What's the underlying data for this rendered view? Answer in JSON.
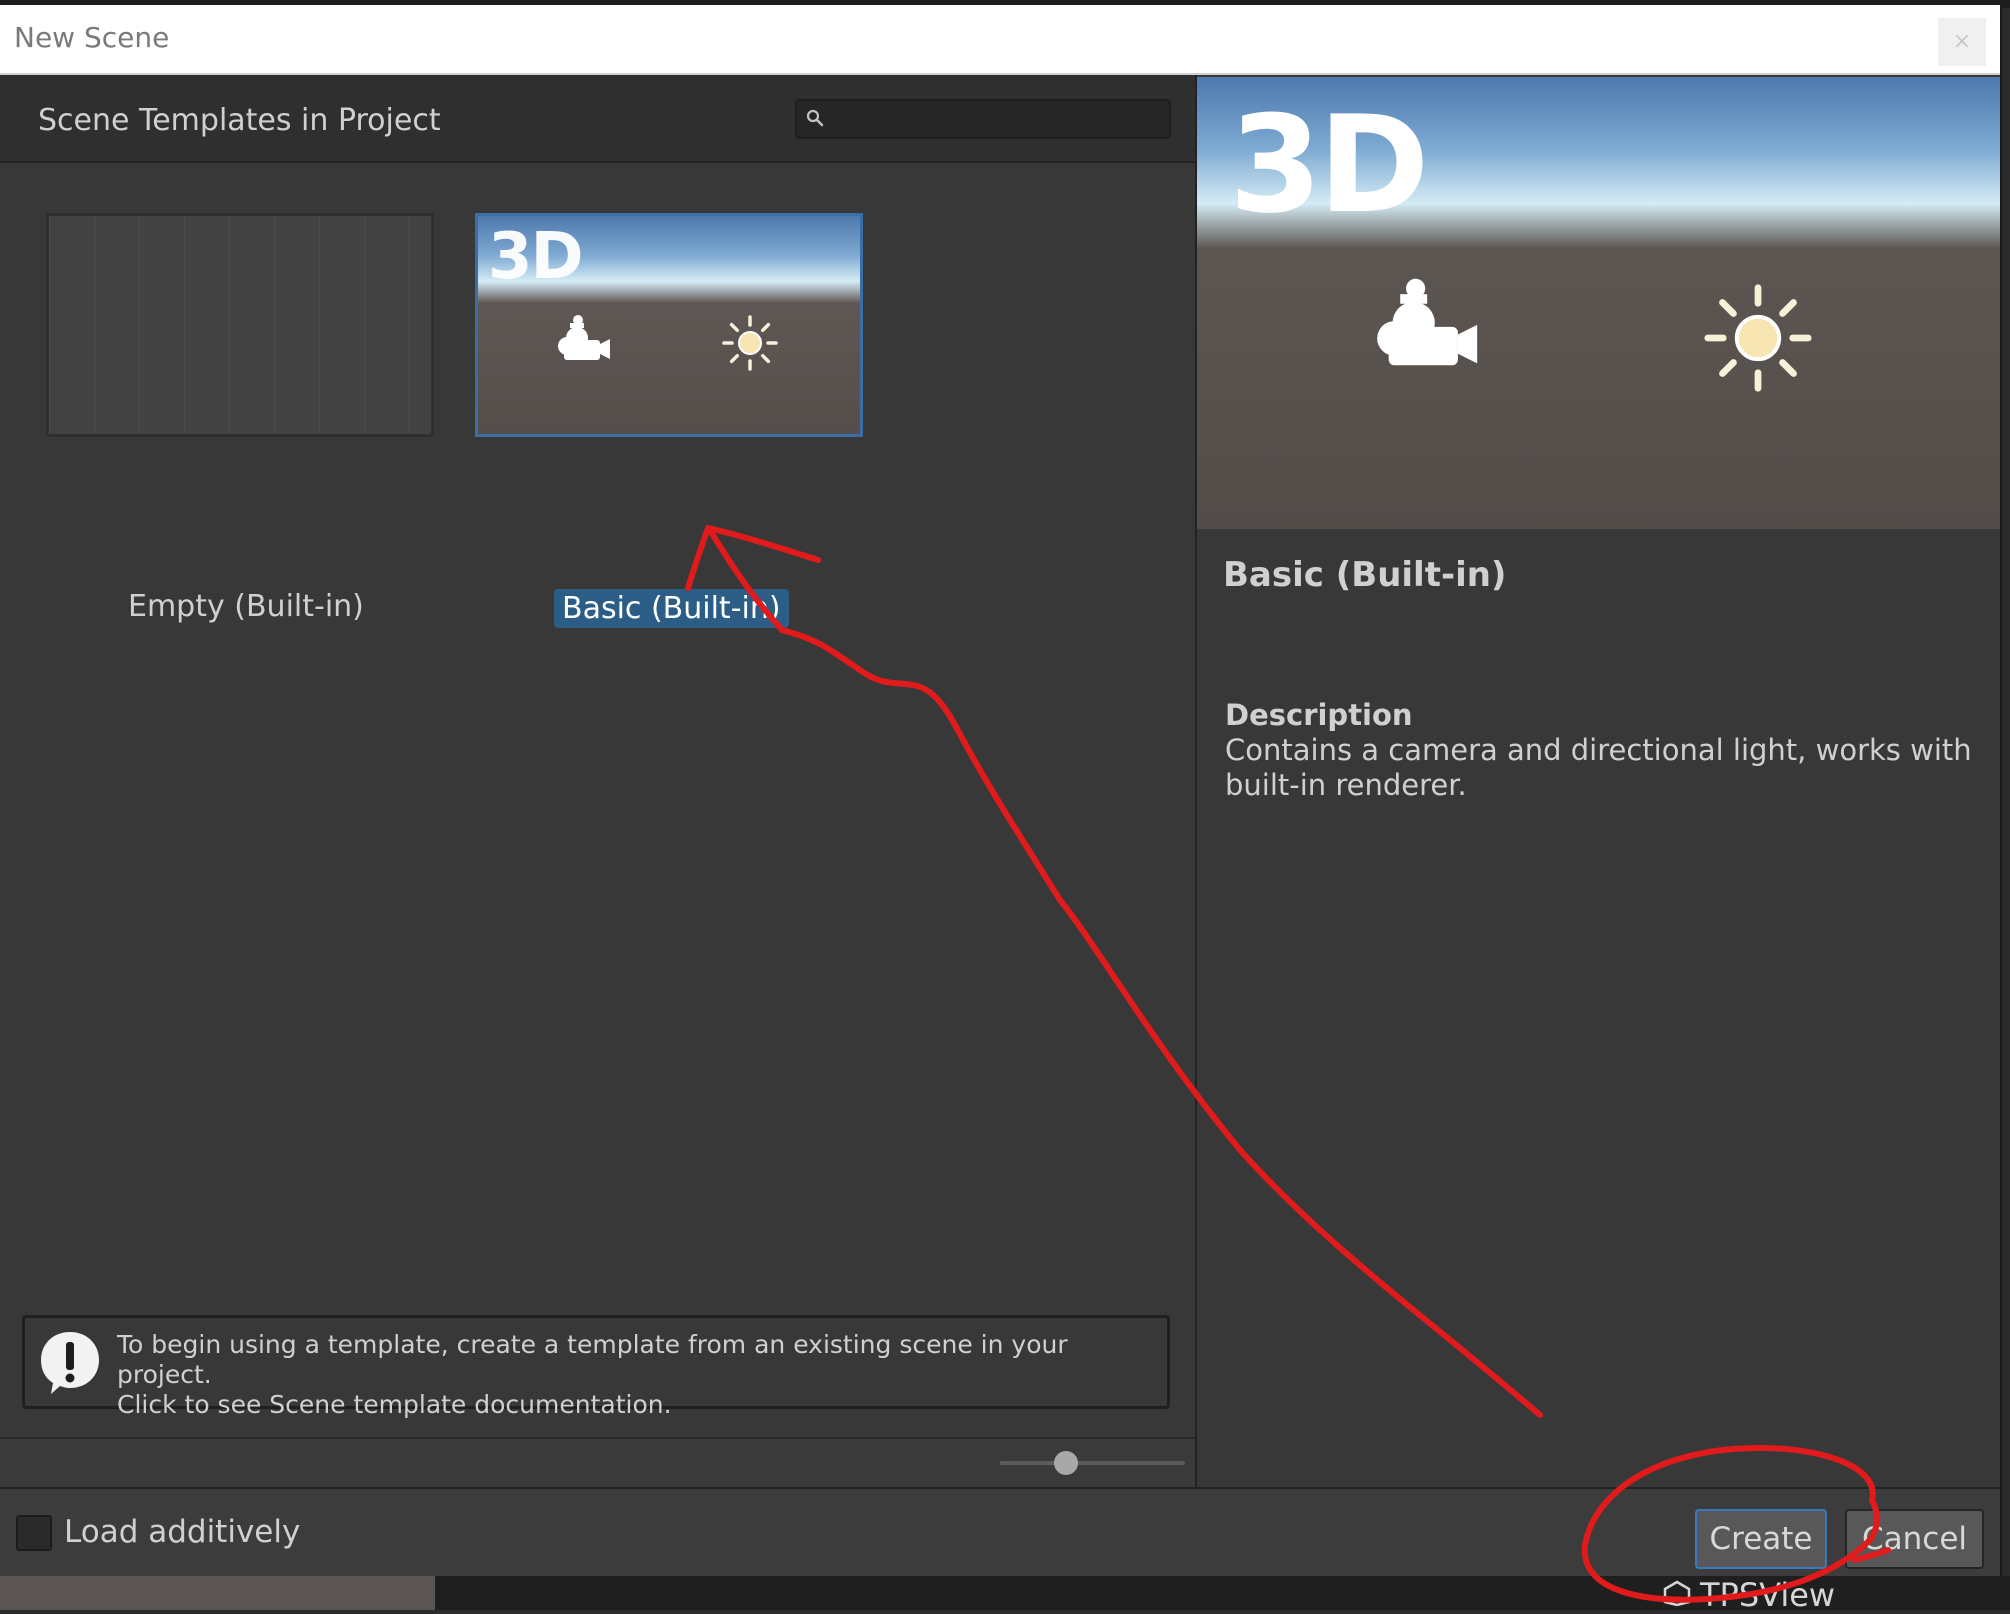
{
  "window": {
    "title": "New Scene",
    "close_glyph": "×"
  },
  "left_panel": {
    "heading": "Scene Templates in Project",
    "search": {
      "value": "",
      "placeholder": ""
    },
    "templates": [
      {
        "label": "Empty (Built-in)",
        "selected": false,
        "thumbnail_text": ""
      },
      {
        "label": "Basic (Built-in)",
        "selected": true,
        "thumbnail_text": "3D"
      }
    ],
    "info_message": {
      "line1": "To begin using a template, create a template from an existing scene in your project.",
      "line2": "Click to see Scene template documentation."
    },
    "zoom_slider": {
      "value": 0.35
    }
  },
  "right_panel": {
    "preview_text": "3D",
    "title": "Basic (Built-in)",
    "description_heading": "Description",
    "description_text": "Contains a camera and directional light, works with built-in renderer."
  },
  "bottom_bar": {
    "load_additively_label": "Load additively",
    "load_additively_checked": false,
    "create_label": "Create",
    "cancel_label": "Cancel"
  },
  "background": {
    "tab_label": "TPSView"
  },
  "colors": {
    "window_bg": "#383838",
    "header_bg": "#2f2f2f",
    "selection": "#2c5d87",
    "accent_border": "#3a79c2",
    "annotation_red": "#e11b1b"
  },
  "icons": [
    "search-icon",
    "camera-icon",
    "sun-icon",
    "info-icon",
    "close-icon",
    "unity-icon"
  ]
}
